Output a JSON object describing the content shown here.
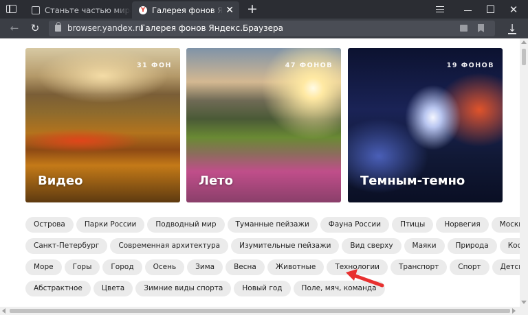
{
  "browser": {
    "tabs": [
      {
        "label": "Станьте частью мира Duck",
        "icon": "page-icon"
      },
      {
        "label": "Галерея фонов Яндекс.Б",
        "icon": "yandex-icon",
        "favicon_glyph": "Y",
        "close_glyph": "✕"
      }
    ],
    "new_tab_glyph": "+",
    "window": {
      "close_glyph": "✕"
    },
    "address": {
      "domain": "browser.yandex.ru",
      "page_title": "Галерея фонов Яндекс.Браузера"
    },
    "nav": {
      "back_glyph": "←",
      "reload_glyph": "↻",
      "download_glyph": "↓"
    }
  },
  "gallery": {
    "cards": [
      {
        "count": "31 ФОН",
        "title": "Видео"
      },
      {
        "count": "47 ФОНОВ",
        "title": "Лето"
      },
      {
        "count": "19 ФОНОВ",
        "title": "Темным-темно"
      }
    ]
  },
  "tags": {
    "row1": [
      "Острова",
      "Парки России",
      "Подводный мир",
      "Туманные пейзажи",
      "Фауна России",
      "Птицы",
      "Норвегия",
      "Москва"
    ],
    "row2": [
      "Санкт-Петербург",
      "Современная архитектура",
      "Изумительные пейзажи",
      "Вид сверху",
      "Маяки",
      "Природа",
      "Космос"
    ],
    "row3": [
      "Море",
      "Горы",
      "Город",
      "Осень",
      "Зима",
      "Весна",
      "Животные",
      "Технологии",
      "Транспорт",
      "Спорт",
      "Детские"
    ],
    "row4": [
      "Абстрактное",
      "Цвета",
      "Зимние виды спорта",
      "Новый год",
      "Поле, мяч, команда"
    ]
  },
  "annotation": {
    "arrow_color": "#e8302f"
  }
}
